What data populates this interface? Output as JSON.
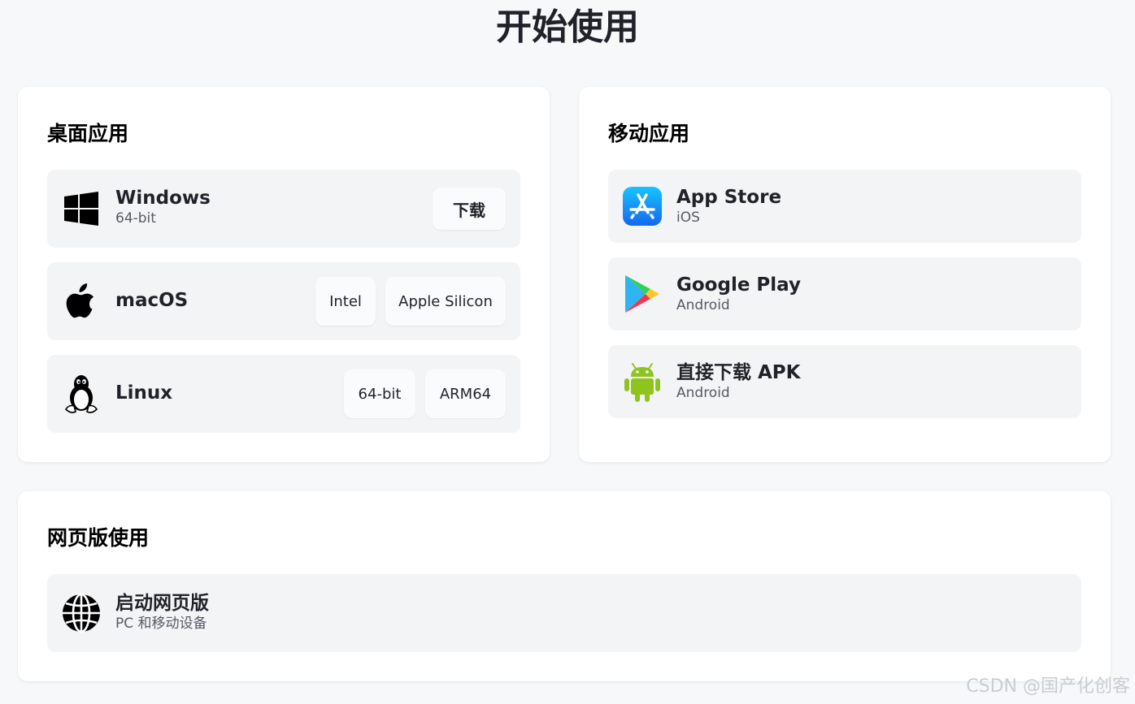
{
  "page": {
    "title": "开始使用"
  },
  "desktop": {
    "title": "桌面应用",
    "windows": {
      "name": "Windows",
      "sub": "64-bit",
      "download_label": "下载",
      "icon": "windows-icon"
    },
    "macos": {
      "name": "macOS",
      "buttons": [
        "Intel",
        "Apple Silicon"
      ],
      "icon": "apple-icon"
    },
    "linux": {
      "name": "Linux",
      "buttons": [
        "64-bit",
        "ARM64"
      ],
      "icon": "tux-icon"
    }
  },
  "mobile": {
    "title": "移动应用",
    "items": [
      {
        "name": "App Store",
        "sub": "iOS",
        "icon": "app-store-icon"
      },
      {
        "name": "Google Play",
        "sub": "Android",
        "icon": "google-play-icon"
      },
      {
        "name": "直接下载 APK",
        "sub": "Android",
        "icon": "android-icon"
      }
    ]
  },
  "web": {
    "title": "网页版使用",
    "launch": {
      "name": "启动网页版",
      "sub": "PC 和移动设备",
      "icon": "globe-icon"
    }
  },
  "watermark": "CSDN @国产化创客",
  "colors": {
    "background": "#f7f8fa",
    "card": "#ffffff",
    "row": "#f3f4f6",
    "app_store_blue": "#1a8cff",
    "android_green": "#8fc31f"
  }
}
